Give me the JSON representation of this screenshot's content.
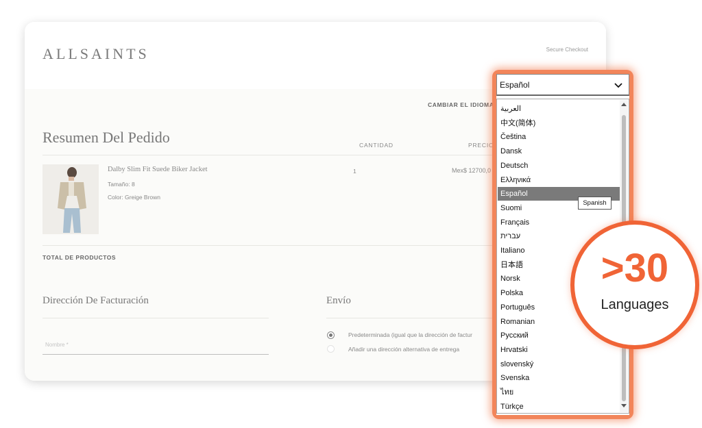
{
  "header": {
    "brand": "ALLSAINTS",
    "secure": "Secure Checkout"
  },
  "checkout": {
    "change_language": "CAMBIAR EL IDIOMA",
    "summary_title": "Resumen Del Pedido",
    "col_quantity": "CANTIDAD",
    "col_price": "PRECIO",
    "product": {
      "name": "Dalby Slim Fit Suede Biker Jacket",
      "size": "Tamaño:  8",
      "color": "Color:  Greige Brown",
      "quantity": "1",
      "price": "Mex$ 12700,0"
    },
    "total_label": "TOTAL DE PRODUCTOS",
    "billing_title": "Dirección De Facturación",
    "shipping_title": "Envío",
    "name_placeholder": "Nombre *",
    "option_default": "Predeterminada (igual que la dirección de factur",
    "option_alt": "Añadir una dirección alternativa de entrega"
  },
  "language_dropdown": {
    "selected": "Español",
    "items": [
      "العربية",
      "中文(简体)",
      "Čeština",
      "Dansk",
      "Deutsch",
      "Ελληνικά",
      "Español",
      "Suomi",
      "Français",
      "עברית",
      "Italiano",
      "日本語",
      "Norsk",
      "Polska",
      "Português",
      "Romanian",
      "Русский",
      "Hrvatski",
      "slovenský",
      "Svenska",
      "ไทย",
      "Türkçe"
    ],
    "tooltip": "Spanish"
  },
  "badge": {
    "big": ">30",
    "small": "Languages",
    "color": "#f06436"
  }
}
